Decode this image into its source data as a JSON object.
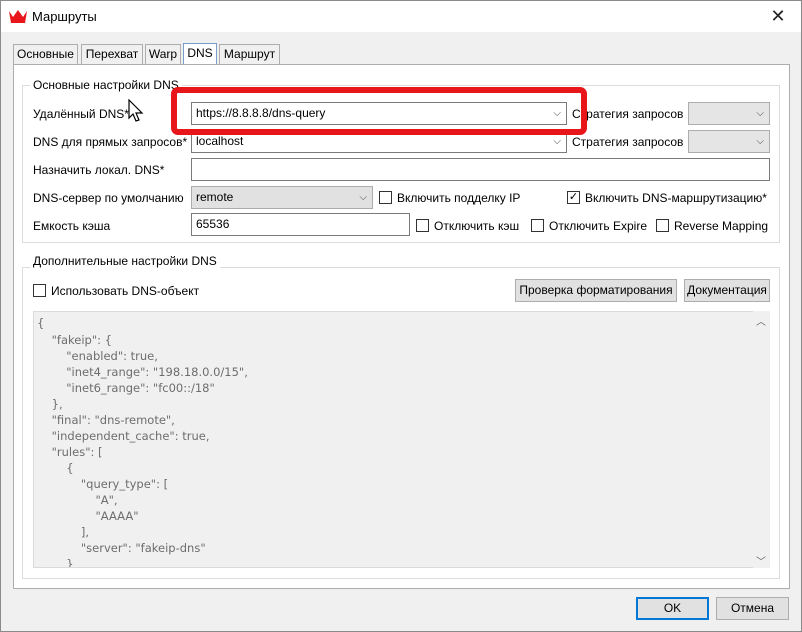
{
  "window": {
    "title": "Маршруты",
    "close": "✕"
  },
  "tabs": [
    {
      "label": "Основные"
    },
    {
      "label": "Перехват"
    },
    {
      "label": "Warp"
    },
    {
      "label": "DNS"
    },
    {
      "label": "Маршрут"
    }
  ],
  "basic": {
    "group_title": "Основные настройки DNS",
    "remote_label": "Удалённый DNS*",
    "remote_value": "https://8.8.8.8/dns-query",
    "strategy_label": "Стратегия запросов",
    "direct_label": "DNS для прямых запросов*",
    "direct_value": "localhost",
    "strategy_label2": "Стратегия запросов",
    "local_label": "Назначить локал. DNS*",
    "local_value": "",
    "default_label": "DNS-сервер по умолчанию",
    "default_value": "remote",
    "fakeip_label": "Включить подделку IP",
    "dns_routing_label": "Включить DNS-маршрутизацию*",
    "cache_label": "Емкость кэша",
    "cache_value": "65536",
    "disable_cache_label": "Отключить кэш",
    "disable_expire_label": "Отключить Expire",
    "reverse_mapping_label": "Reverse Mapping"
  },
  "extra": {
    "group_title": "Дополнительные настройки DNS",
    "use_object_label": "Использовать DNS-объект",
    "check_format_button": "Проверка форматирования",
    "docs_button": "Документация",
    "code_lines": [
      "{",
      "    \"fakeip\": {",
      "        \"enabled\": true,",
      "        \"inet4_range\": \"198.18.0.0/15\",",
      "        \"inet6_range\": \"fc00::/18\"",
      "    },",
      "    \"final\": \"dns-remote\",",
      "    \"independent_cache\": true,",
      "    \"rules\": [",
      "        {",
      "            \"query_type\": [",
      "                \"A\",",
      "                \"AAAA\"",
      "            ],",
      "            \"server\": \"fakeip-dns\"",
      "        }"
    ]
  },
  "footer": {
    "ok": "OK",
    "cancel": "Отмена"
  },
  "icons": {
    "check": "✓",
    "chevron": "⌵",
    "up": "︿",
    "down": "﹀"
  },
  "colors": {
    "highlight": "#e8151b",
    "accent": "#0078d7"
  }
}
